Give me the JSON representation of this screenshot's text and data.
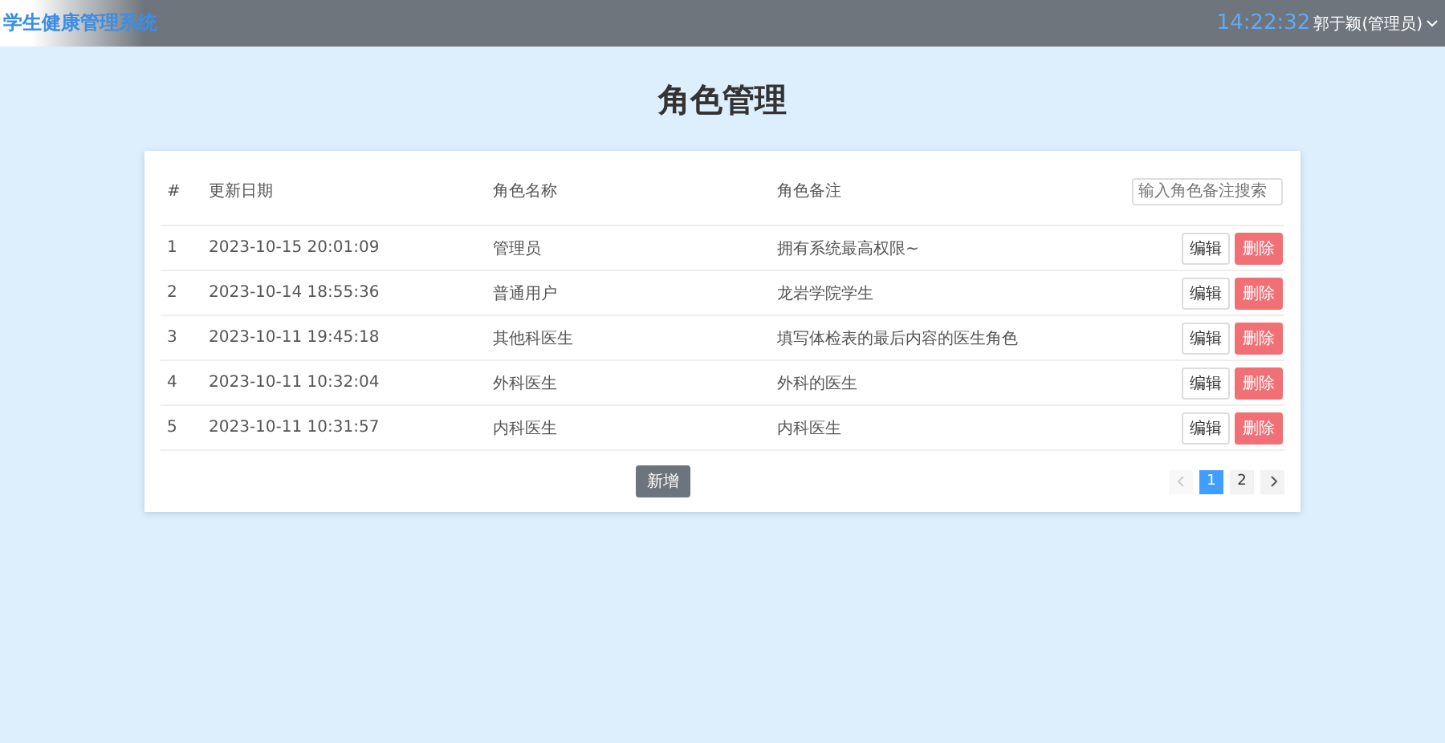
{
  "header": {
    "title": "学生健康管理系统",
    "time": "14:22:32",
    "user": "郭于颖(管理员)"
  },
  "page_title": "角色管理",
  "search": {
    "placeholder": "输入角色备注搜索"
  },
  "table": {
    "columns": [
      "#",
      "更新日期",
      "角色名称",
      "角色备注"
    ],
    "rows": [
      {
        "cells": [
          "1",
          "2023-10-15 20:01:09",
          "管理员",
          "拥有系统最高权限~"
        ],
        "actions": [
          "编辑",
          "删除"
        ]
      },
      {
        "cells": [
          "2",
          "2023-10-14 18:55:36",
          "普通用户",
          "龙岩学院学生"
        ],
        "actions": [
          "编辑",
          "删除"
        ]
      },
      {
        "cells": [
          "3",
          "2023-10-11 19:45:18",
          "其他科医生",
          "填写体检表的最后内容的医生角色"
        ],
        "actions": [
          "编辑",
          "删除"
        ]
      },
      {
        "cells": [
          "4",
          "2023-10-11 10:32:04",
          "外科医生",
          "外科的医生"
        ],
        "actions": [
          "编辑",
          "删除"
        ]
      },
      {
        "cells": [
          "5",
          "2023-10-11 10:31:57",
          "内科医生",
          "内科医生"
        ],
        "actions": [
          "编辑",
          "删除"
        ]
      }
    ]
  },
  "add_button": "新增",
  "pagination": {
    "prev_disabled": true,
    "pages": [
      {
        "label": "1",
        "selected": true
      },
      {
        "label": "2",
        "selected": false
      }
    ]
  }
}
